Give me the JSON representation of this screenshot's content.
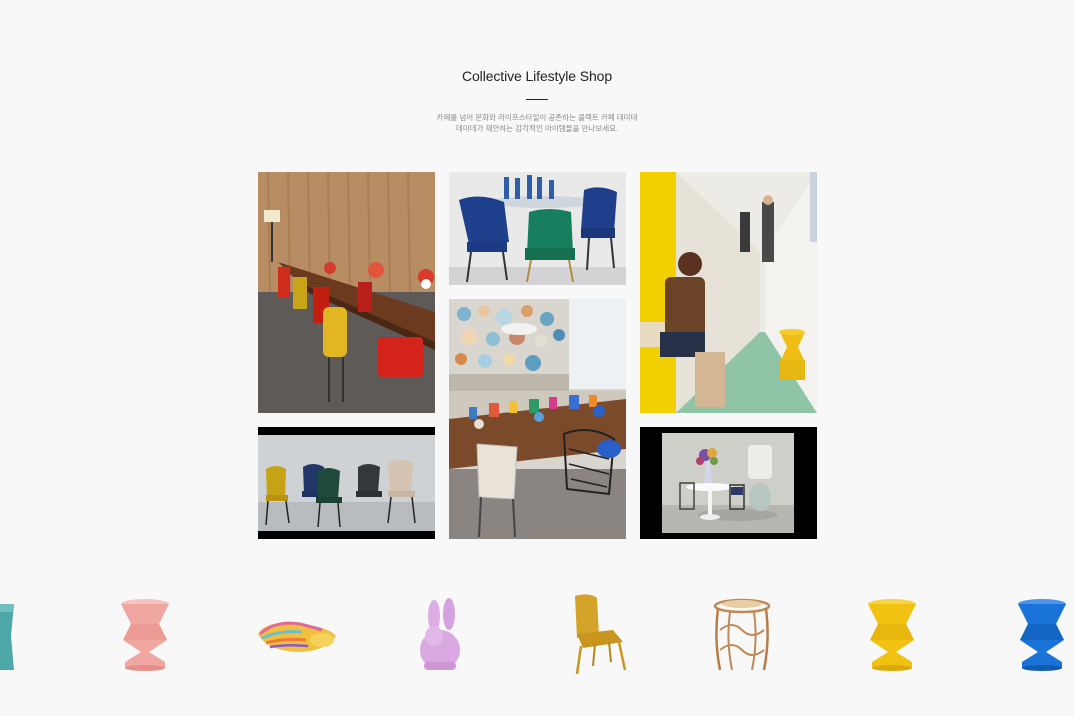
{
  "section": {
    "title": "Collective Lifestyle Shop",
    "description_line1": "카페를 넘어 문화와 라이프스타일이 공존하는 콜렉트 카페 데미데",
    "description_line2": "데미데가 제안하는 감각적인 아이템들을 만나보세요."
  },
  "gallery": {
    "photos": [
      {
        "subject": "dining room with colorful chairs"
      },
      {
        "subject": "velvet chairs and glassware"
      },
      {
        "subject": "office hallway with yellow stool"
      },
      {
        "subject": "row of colorful chairs"
      },
      {
        "subject": "cafe table with ceramics wall"
      },
      {
        "subject": "white table with lamp"
      }
    ]
  },
  "products": [
    {
      "icon": "teal-stool-icon",
      "color": "#4fa8a8"
    },
    {
      "icon": "pink-zig-zag-stool-icon",
      "color": "#f1a7a1"
    },
    {
      "icon": "shell-tray-icon",
      "color": "#f0c040"
    },
    {
      "icon": "lilac-rabbit-chair-icon",
      "color": "#d9a8e0"
    },
    {
      "icon": "mustard-chair-icon",
      "color": "#d4a32a"
    },
    {
      "icon": "rattan-side-table-icon",
      "color": "#c08a56"
    },
    {
      "icon": "yellow-zig-zag-stool-icon",
      "color": "#f2c213"
    },
    {
      "icon": "blue-zig-zag-stool-icon",
      "color": "#1a73d9"
    }
  ]
}
